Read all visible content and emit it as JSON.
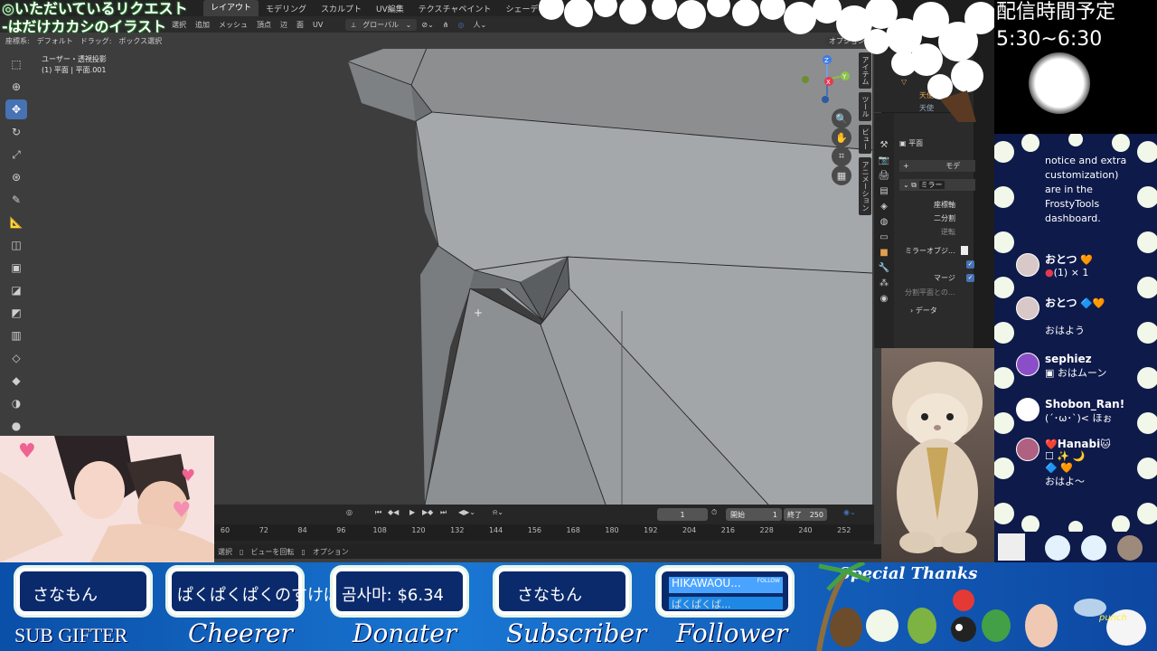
{
  "overlay_title": {
    "line1": "◎いただいているリクエスト",
    "line2": "-はだけカカシのイラスト"
  },
  "schedule": {
    "title": "配信時間予定",
    "time": "5:30~6:30"
  },
  "blender": {
    "workspaces": [
      "レイアウト",
      "モデリング",
      "スカルプト",
      "UV編集",
      "テクスチャペイント",
      "シェーディ"
    ],
    "header_menu": [
      "選択",
      "追加",
      "メッシュ",
      "頂点",
      "辺",
      "面",
      "UV"
    ],
    "transform": "グローバル",
    "tool_header": {
      "coord_label": "座標系:",
      "coord_value": "デフォルト",
      "drag_label": "ドラッグ:",
      "drag_value": "ボックス選択"
    },
    "options": "オプション",
    "view_label": {
      "line1": "ユーザー・透視投影",
      "line2": "(1) 平面 | 平面.001"
    },
    "gizmo": {
      "z": "Z",
      "y": "Y",
      "x": "X"
    },
    "side_tabs": [
      "アイテム",
      "ツール",
      "ビュー",
      "アニメーション"
    ],
    "properties": {
      "object": "平面",
      "modifier_add": "モデ",
      "modifier_name": "ミラー",
      "axis": "座標軸",
      "bisect": "二分割",
      "flip": "逆転",
      "mirror_object": "ミラーオブジ...",
      "merge": "マージ",
      "clip": "分割平面との...",
      "data": "データ"
    },
    "outliner_rows": [
      "▽",
      "天使",
      "天使"
    ],
    "timeline": {
      "frame": "1",
      "start_label": "開始",
      "start": "1",
      "end_label": "終了",
      "end": "250",
      "ticks": [
        "60",
        "72",
        "84",
        "96",
        "108",
        "120",
        "132",
        "144",
        "156",
        "168",
        "180",
        "192",
        "204",
        "216",
        "228",
        "240",
        "252"
      ]
    },
    "status": {
      "select": "選択",
      "rotate": "ビューを回転",
      "options": "オプション"
    },
    "colors": {
      "accent": "#4772b3",
      "bg": "#3d3d3d"
    }
  },
  "chat": [
    {
      "name": "",
      "text": "notice and extra customization) are in the FrostyTools dashboard."
    },
    {
      "name": "おとつ",
      "text": "(1) × 1",
      "badge": "🧡"
    },
    {
      "name": "おとつ",
      "text": "おはよう",
      "badge": "🔷🧡"
    },
    {
      "name": "sephiez",
      "text": "おはムーン"
    },
    {
      "name": "Shobon_Ran!",
      "text": "(´･ω･`)< ほぉ"
    },
    {
      "name": "Hanabi",
      "text": "おはよ〜",
      "badge": "❤️"
    }
  ],
  "bottom": {
    "boxes": [
      {
        "value": "さなもん",
        "label": "SUB GIFTER"
      },
      {
        "value": "ぱくぱくぱくのすけぱ",
        "label": "Cheerer"
      },
      {
        "value": "곰사마: $6.34",
        "label": "Donater"
      },
      {
        "value": "さなもん",
        "label": "Subscriber"
      },
      {
        "value": "HIKAWAOU...",
        "value2": "ぱくぱくば...",
        "follow": "FOLLOW",
        "label": "Follower"
      }
    ],
    "special": "Special Thanks",
    "punch": "punch"
  }
}
